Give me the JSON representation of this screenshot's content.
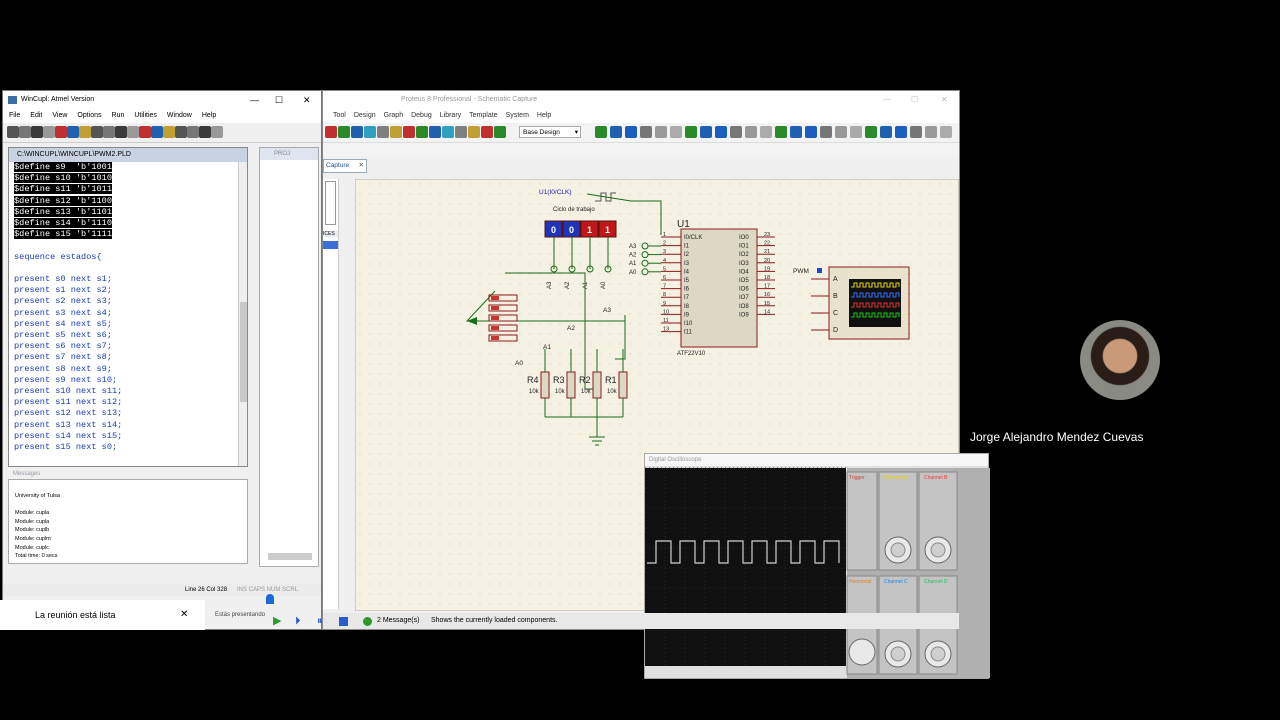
{
  "wincupl": {
    "title": "WinCupl: Atmel Version",
    "menu": [
      "File",
      "Edit",
      "View",
      "Options",
      "Run",
      "Utilities",
      "Window",
      "Help"
    ],
    "editor_title": "C:\\WINCUPL\\WINCUPL\\PWM2.PLD",
    "defines": [
      "$define s9  'b'1001",
      "$define s10 'b'1010",
      "$define s11 'b'1011",
      "$define s12 'b'1100",
      "$define s13 'b'1101",
      "$define s14 'b'1110",
      "$define s15 'b'1111"
    ],
    "sequence_line": "sequence estados{",
    "present_lines": [
      "present s0 next s1;",
      "present s1 next s2;",
      "present s2 next s3;",
      "present s3 next s4;",
      "present s4 next s5;",
      "present s5 next s6;",
      "present s6 next s7;",
      "present s7 next s8;",
      "present s8 next s9;",
      "present s9 next s10;",
      "present s10 next s11;",
      "present s11 next s12;",
      "present s12 next s13;",
      "present s13 next s14;",
      "present s14 next s15;",
      "present s15 next s0;"
    ],
    "messages_title": "Messages",
    "messages": [
      "University of Tulsa",
      "",
      "Module: cupla",
      "Module: cupla",
      "Module: cuplb",
      "Module: cuplm",
      "Module: cuplc",
      "Total time: 0 secs"
    ],
    "status": "Line 26 Col 328",
    "status_flags": "INS CAPS NUM SCRL"
  },
  "proteus": {
    "title": "Proteus 8 Professional - Schematic Capture",
    "menu": [
      "Tool",
      "Design",
      "Graph",
      "Debug",
      "Library",
      "Template",
      "System",
      "Help"
    ],
    "design_select": "Base Design",
    "tab_label": "Capture",
    "sidebar_label": "ICES",
    "status_messages": "2 Message(s)",
    "status_hint": "Shows the currently loaded components."
  },
  "schematic": {
    "clock_label": "U1(I0/CLK)",
    "duty_label": "Ciclo de trabajo",
    "switch_values": [
      "0",
      "0",
      "1",
      "1"
    ],
    "switch_pins": [
      "A3",
      "A2",
      "A1",
      "A0"
    ],
    "chip_ref": "U1",
    "chip_name": "ATF22V10",
    "chip_left_pins": [
      "I0/CLK",
      "I1",
      "I2",
      "I3",
      "I4",
      "I5",
      "I6",
      "I7",
      "I8",
      "I9",
      "I10",
      "I11"
    ],
    "chip_left_nums": [
      "1",
      "2",
      "3",
      "4",
      "5",
      "6",
      "7",
      "8",
      "9",
      "10",
      "11",
      "13"
    ],
    "chip_right_pins": [
      "IO0",
      "IO1",
      "IO2",
      "IO3",
      "IO4",
      "IO5",
      "IO6",
      "IO7",
      "IO8",
      "IO9"
    ],
    "chip_right_nums": [
      "23",
      "22",
      "21",
      "20",
      "19",
      "18",
      "17",
      "16",
      "15",
      "14"
    ],
    "input_labels": [
      "A3",
      "A2",
      "A1",
      "A0"
    ],
    "pwm_label": "PWM",
    "scope_channels": [
      "A",
      "B",
      "C",
      "D"
    ],
    "resistors": [
      {
        "ref": "R4",
        "value": "10k"
      },
      {
        "ref": "R3",
        "value": "10k"
      },
      {
        "ref": "R2",
        "value": "10k"
      },
      {
        "ref": "R1",
        "value": "10k"
      }
    ],
    "switch_net_labels": [
      "A3",
      "A2",
      "A1",
      "A0"
    ]
  },
  "oscilloscope": {
    "title": "Digital Oscilloscope",
    "channels": [
      "Channel A",
      "Channel B",
      "Channel C",
      "Channel D"
    ],
    "trigger_label": "Trigger",
    "horizontal_label": "Horizontal"
  },
  "meeting": {
    "participant_name": "Jorge Alejandro Mendez Cuevas",
    "toast": "La reunión está lista",
    "present_label": "Estás presentando"
  },
  "colors": {
    "schematic_bg": "#f5f2e3",
    "wire": "#1a6b1a",
    "component": "#8b1a1a",
    "chip_fill": "#ddd8c4",
    "scope_trace": "#d0d0d0"
  }
}
